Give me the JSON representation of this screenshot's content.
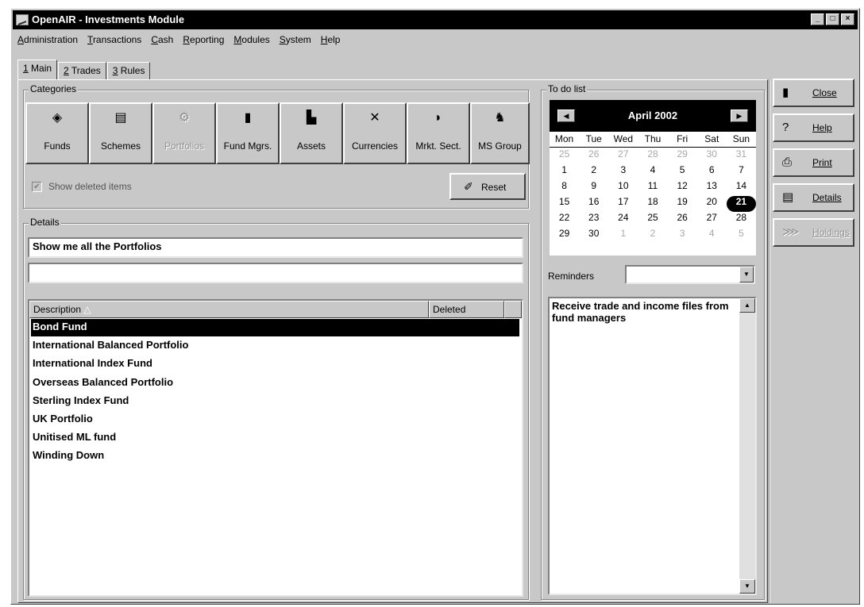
{
  "window": {
    "title": "OpenAIR - Investments Module",
    "controls": [
      "_",
      "□",
      "×"
    ]
  },
  "menu": [
    {
      "u": "A",
      "rest": "dministration"
    },
    {
      "u": "T",
      "rest": "ransactions"
    },
    {
      "u": "C",
      "rest": "ash"
    },
    {
      "u": "R",
      "rest": "eporting"
    },
    {
      "u": "M",
      "rest": "odules"
    },
    {
      "u": "S",
      "rest": "ystem"
    },
    {
      "u": "H",
      "rest": "elp"
    }
  ],
  "tabs": [
    {
      "num": "1",
      "label": "Main"
    },
    {
      "num": "2",
      "label": "Trades"
    },
    {
      "num": "3",
      "label": "Rules"
    }
  ],
  "categories": {
    "label": "Categories",
    "buttons": [
      {
        "label": "Funds",
        "icon": "funds-icon",
        "disabled": false
      },
      {
        "label": "Schemes",
        "icon": "schemes-icon",
        "disabled": false
      },
      {
        "label": "Portfolios",
        "icon": "portfolios-icon",
        "disabled": true
      },
      {
        "label": "Fund Mgrs.",
        "icon": "fund-managers-icon",
        "disabled": false
      },
      {
        "label": "Assets",
        "icon": "assets-icon",
        "disabled": false
      },
      {
        "label": "Currencies",
        "icon": "currencies-icon",
        "disabled": false
      },
      {
        "label": "Mrkt. Sect.",
        "icon": "market-sector-icon",
        "disabled": false
      },
      {
        "label": "MS Group",
        "icon": "ms-group-icon",
        "disabled": false
      }
    ],
    "show_deleted": "Show deleted items",
    "reset": "Reset"
  },
  "details": {
    "label": "Details",
    "field1": "Show me all the Portfolios",
    "field2": "",
    "columns": [
      "Description",
      "Deleted"
    ],
    "rows": [
      "Bond Fund",
      "International Balanced Portfolio",
      "International Index Fund",
      "Overseas Balanced Portfolio",
      "Sterling Index Fund",
      "UK Portfolio",
      "Unitised ML fund",
      "Winding Down"
    ],
    "selected_index": 0
  },
  "todo": {
    "label": "To do list",
    "calendar": {
      "month": "April 2002",
      "days": [
        "Mon",
        "Tue",
        "Wed",
        "Thu",
        "Fri",
        "Sat",
        "Sun"
      ],
      "weeks": [
        [
          "25",
          "26",
          "27",
          "28",
          "29",
          "30",
          "31"
        ],
        [
          "1",
          "2",
          "3",
          "4",
          "5",
          "6",
          "7"
        ],
        [
          "8",
          "9",
          "10",
          "11",
          "12",
          "13",
          "14"
        ],
        [
          "15",
          "16",
          "17",
          "18",
          "19",
          "20",
          "21"
        ],
        [
          "22",
          "23",
          "24",
          "25",
          "26",
          "27",
          "28"
        ],
        [
          "29",
          "30",
          "1",
          "2",
          "3",
          "4",
          "5"
        ]
      ],
      "today": "21"
    },
    "reminders_label": "Reminders",
    "reminders_value": "",
    "note": "Receive trade and income files from fund managers"
  },
  "side_buttons": [
    {
      "label": "Close",
      "icon": "close-door-icon",
      "disabled": false
    },
    {
      "label": "Help",
      "icon": "help-icon",
      "disabled": false
    },
    {
      "label": "Print",
      "icon": "print-icon",
      "disabled": false
    },
    {
      "label": "Details",
      "icon": "details-icon",
      "disabled": false
    },
    {
      "label": "Holdings",
      "icon": "holdings-icon",
      "disabled": true
    }
  ]
}
